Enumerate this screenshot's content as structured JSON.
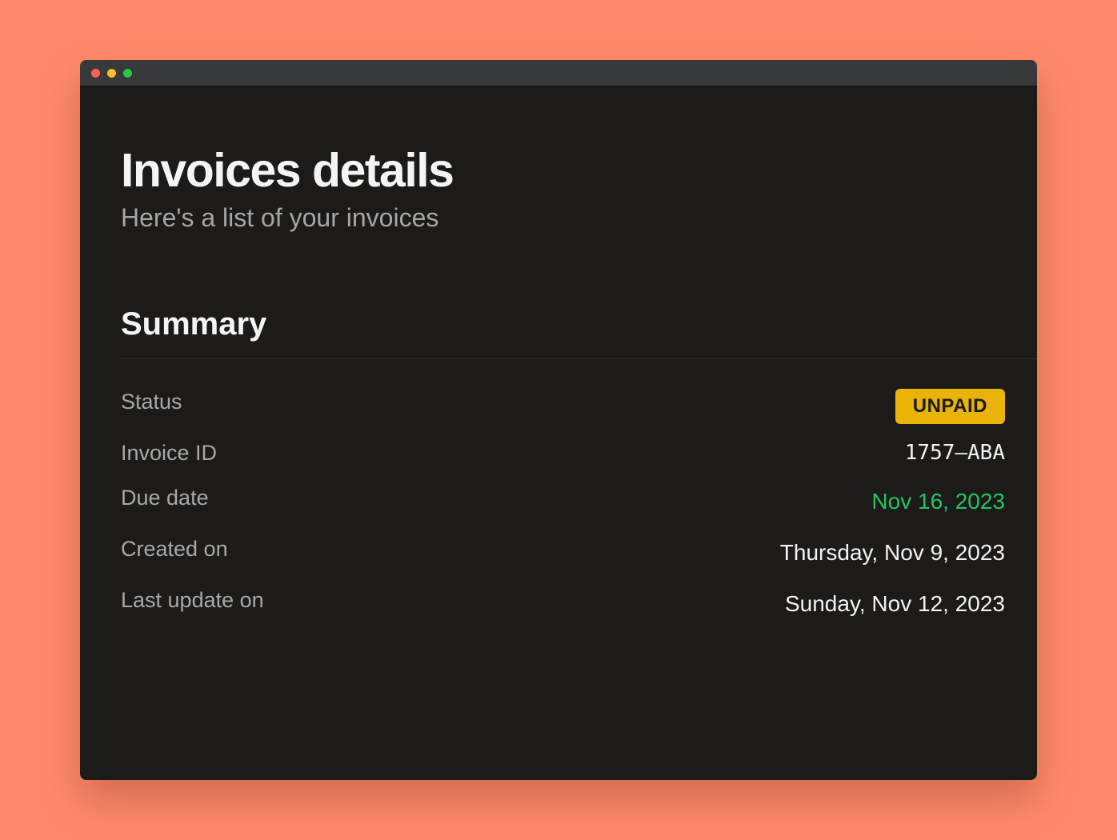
{
  "colors": {
    "background": "#ff8a6b",
    "window": "#1c1b1a",
    "titlebar": "#38393b",
    "badge": "#eab308",
    "due_date": "#22c55e"
  },
  "header": {
    "title": "Invoices details",
    "subtitle": "Here's a list of your invoices"
  },
  "summary": {
    "title": "Summary",
    "status": {
      "label": "Status",
      "value": "UNPAID"
    },
    "invoice_id": {
      "label": "Invoice ID",
      "value": "1757–ABA"
    },
    "due_date": {
      "label": "Due date",
      "value": "Nov 16, 2023"
    },
    "created_on": {
      "label": "Created on",
      "value": "Thursday, Nov 9, 2023"
    },
    "last_update": {
      "label": "Last update on",
      "value": "Sunday, Nov 12, 2023"
    }
  }
}
